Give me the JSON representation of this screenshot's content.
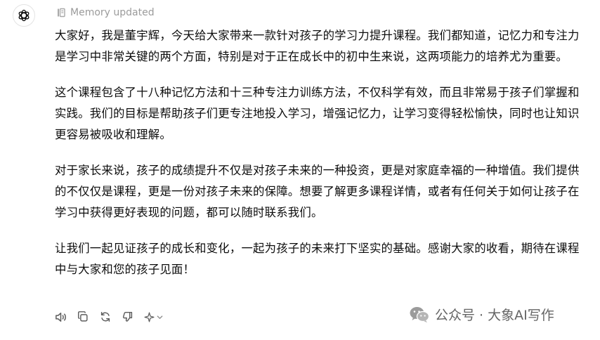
{
  "memory_label": "Memory updated",
  "message": {
    "paragraphs": [
      "大家好，我是董宇辉，今天给大家带来一款针对孩子的学习力提升课程。我们都知道，记忆力和专注力是学习中非常关键的两个方面，特别是对于正在成长中的初中生来说，这两项能力的培养尤为重要。",
      "这个课程包含了十八种记忆方法和十三种专注力训练方法，不仅科学有效，而且非常易于孩子们掌握和实践。我们的目标是帮助孩子们更专注地投入学习，增强记忆力，让学习变得轻松愉快，同时也让知识更容易被吸收和理解。",
      "对于家长来说，孩子的成绩提升不仅是对孩子未来的一种投资，更是对家庭幸福的一种增值。我们提供的不仅仅是课程，更是一份对孩子未来的保障。想要了解更多课程详情，或者有任何关于如何让孩子在学习中获得更好表现的问题，都可以随时联系我们。",
      "让我们一起见证孩子的成长和变化，一起为孩子的未来打下坚实的基础。感谢大家的收看，期待在课程中与大家和您的孩子见面！"
    ]
  },
  "actions": {
    "icons": [
      "speaker-icon",
      "copy-icon",
      "regenerate-icon",
      "thumbs-down-icon",
      "sparkle-icon",
      "chevron-down-icon"
    ]
  },
  "watermark": {
    "text": "公众号 · 大象AI写作"
  }
}
